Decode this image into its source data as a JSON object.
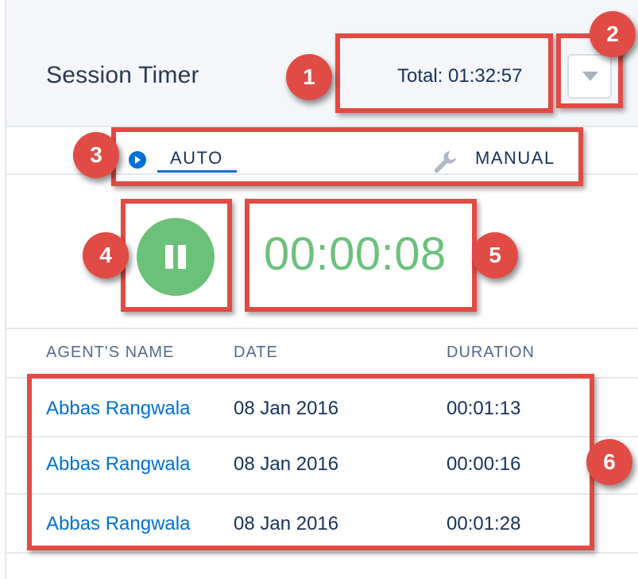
{
  "header": {
    "title": "Session Timer",
    "total": "Total: 01:32:57",
    "dropdown_icon": "chevron-down-icon"
  },
  "tabs": {
    "auto": {
      "label": "AUTO",
      "icon": "play-circle-icon",
      "active": true
    },
    "manual": {
      "label": "MANUAL",
      "icon": "wrench-icon"
    }
  },
  "timer": {
    "button_icon": "pause-icon",
    "elapsed": "00:00:08"
  },
  "table": {
    "columns": [
      "AGENT'S NAME",
      "DATE",
      "DURATION"
    ],
    "rows": [
      {
        "agent": "Abbas Rangwala",
        "date": "08 Jan 2016",
        "duration": "00:01:13"
      },
      {
        "agent": "Abbas Rangwala",
        "date": "08 Jan 2016",
        "duration": "00:00:16"
      },
      {
        "agent": "Abbas Rangwala",
        "date": "08 Jan 2016",
        "duration": "00:01:28"
      }
    ]
  },
  "callouts": [
    "1",
    "2",
    "3",
    "4",
    "5",
    "6"
  ],
  "colors": {
    "accent": "#0070d2",
    "timer_green": "#6cc17a",
    "callout_red": "#e14b45"
  }
}
